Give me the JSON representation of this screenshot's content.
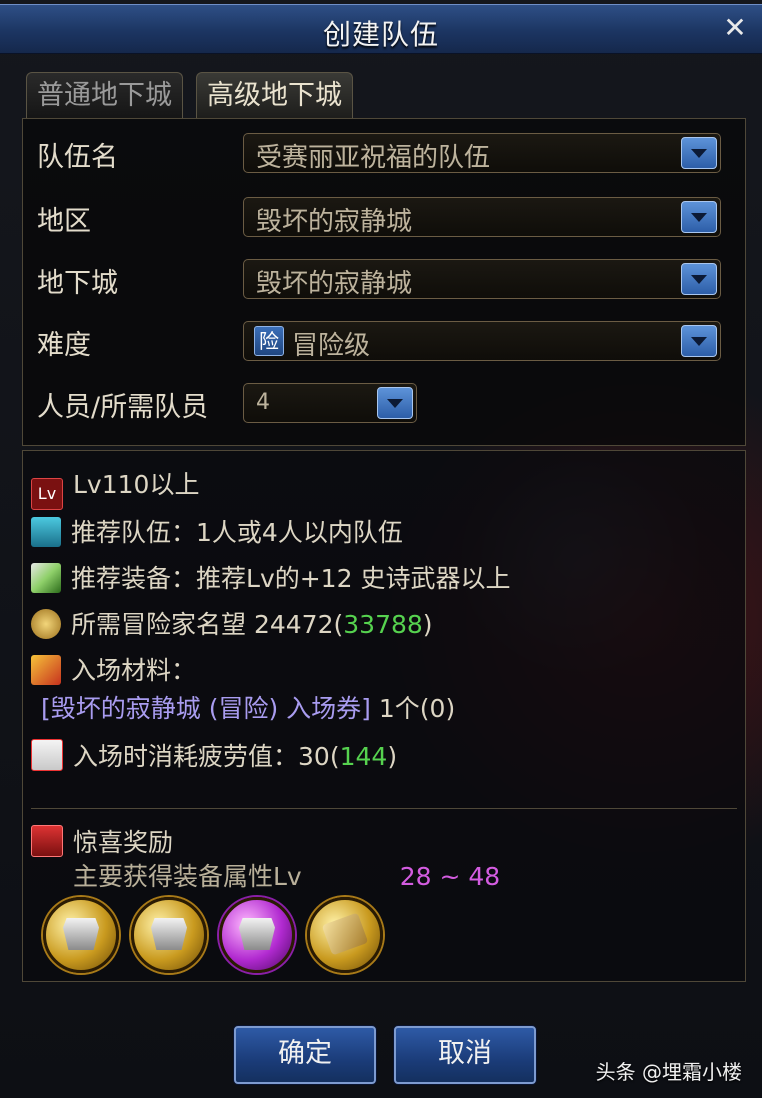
{
  "window": {
    "title": "创建队伍"
  },
  "tabs": [
    {
      "label": "普通地下城",
      "active": false
    },
    {
      "label": "高级地下城",
      "active": true
    }
  ],
  "form": {
    "team_name": {
      "label": "队伍名",
      "value": "受赛丽亚祝福的队伍"
    },
    "region": {
      "label": "地区",
      "value": "毁坏的寂静城"
    },
    "dungeon": {
      "label": "地下城",
      "value": "毁坏的寂静城"
    },
    "difficulty": {
      "label": "难度",
      "icon_text": "险",
      "value": "冒险级"
    },
    "members": {
      "label": "人员/所需队员",
      "value": "4"
    }
  },
  "info": {
    "level_icon_text": "Lv",
    "level_req": "Lv110以上",
    "team_label": "推荐队伍：",
    "team_value": "1人或4人以内队伍",
    "equip_label": "推荐装备：",
    "equip_value": "推荐Lv的+12 史诗武器以上",
    "fame_label": "所需冒险家名望",
    "fame_value": "24472",
    "fame_own": "33788",
    "material_label": "入场材料：",
    "material_item": "[毁坏的寂静城 (冒险) 入场券]",
    "material_count": "1个(0)",
    "fatigue_label": "入场时消耗疲劳值：",
    "fatigue_value": "30",
    "fatigue_own": "144"
  },
  "reward": {
    "title": "惊喜奖励",
    "level_label": "主要获得装备属性Lv",
    "level_range": "28 ~ 48"
  },
  "buttons": {
    "confirm": "确定",
    "cancel": "取消"
  },
  "watermark": "头条 @埋霜小楼",
  "colors": {
    "title_bar": "#1c3562",
    "highlight_green": "#56d24f",
    "link_purple": "#a99cf0",
    "range_pink": "#d35ce0"
  }
}
